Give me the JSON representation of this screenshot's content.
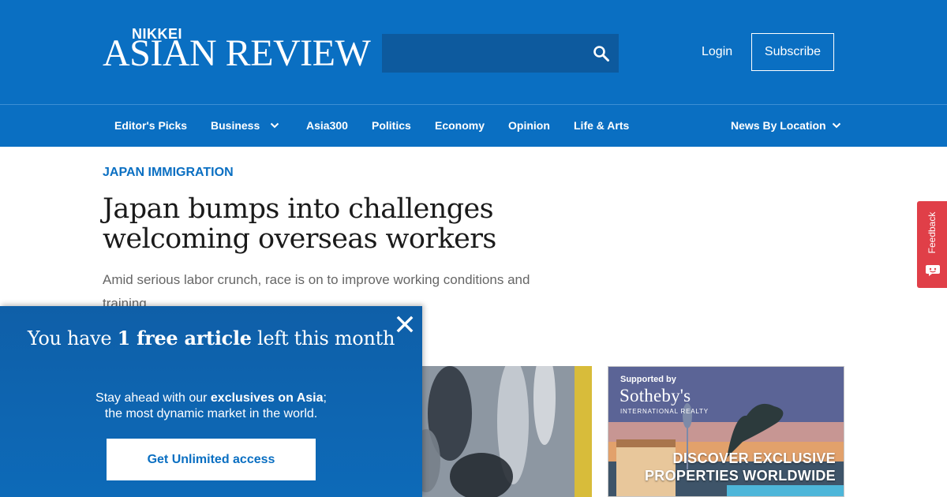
{
  "colors": {
    "brand_blue": "#0a6fc2",
    "search_bg": "#0d5a9e",
    "feedback_red": "#e03f48",
    "text_dark": "#1a1a1a",
    "text_muted": "#666666"
  },
  "header": {
    "logo_top": "NIKKEI",
    "logo_main": "ASIAN REVIEW",
    "search": {
      "value": "",
      "placeholder": "",
      "icon": "search-icon"
    },
    "login_label": "Login",
    "subscribe_label": "Subscribe"
  },
  "nav": {
    "items": [
      {
        "label": "Editor's Picks"
      },
      {
        "label": "Business",
        "has_dropdown": true
      },
      {
        "label": "Asia300"
      },
      {
        "label": "Politics"
      },
      {
        "label": "Economy"
      },
      {
        "label": "Opinion"
      },
      {
        "label": "Life & Arts"
      },
      {
        "label": "News By Location",
        "has_dropdown": true
      }
    ]
  },
  "article": {
    "kicker": "JAPAN IMMIGRATION",
    "headline": "Japan bumps into challenges welcoming overseas workers",
    "standfirst": "Amid serious labor crunch, race is on to improve working conditions and training"
  },
  "ad": {
    "supported_by": "Supported by",
    "brand": "Sotheby's",
    "brand_sub": "INTERNATIONAL REALTY",
    "line1": "DISCOVER EXCLUSIVE",
    "line2": "PROPERTIES WORLDWIDE"
  },
  "feedback": {
    "label": "Feedback"
  },
  "paywall": {
    "title_prefix": "You have ",
    "title_bold": "1 free article",
    "title_suffix": " left this month",
    "body_prefix": "Stay ahead with our ",
    "body_bold": "exclusives on Asia",
    "body_suffix": ";",
    "body_line2": "the most dynamic market in the world.",
    "cta_label": "Get Unlimited access"
  }
}
